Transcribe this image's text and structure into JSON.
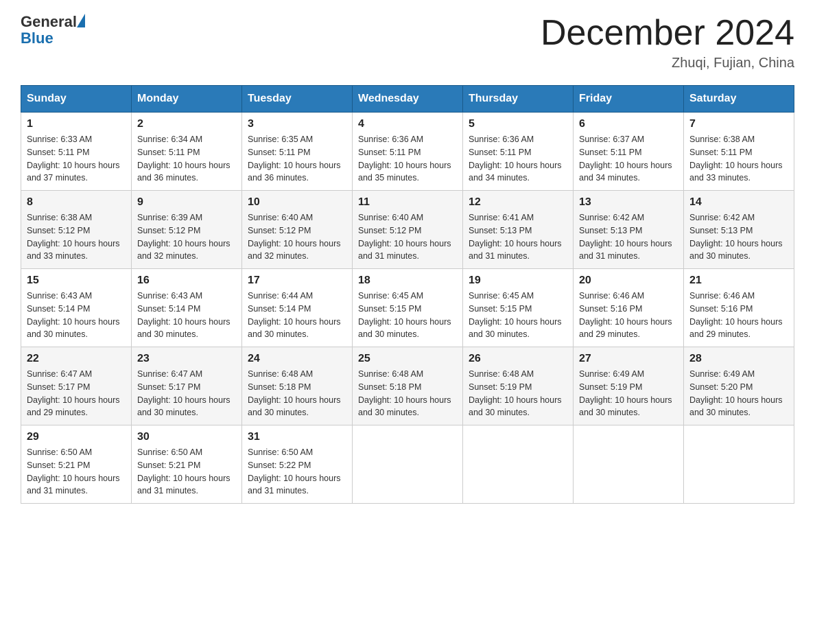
{
  "header": {
    "logo_general": "General",
    "logo_blue": "Blue",
    "month_year": "December 2024",
    "location": "Zhuqi, Fujian, China"
  },
  "calendar": {
    "days_of_week": [
      "Sunday",
      "Monday",
      "Tuesday",
      "Wednesday",
      "Thursday",
      "Friday",
      "Saturday"
    ],
    "weeks": [
      [
        {
          "day": "1",
          "sunrise": "6:33 AM",
          "sunset": "5:11 PM",
          "daylight": "10 hours and 37 minutes."
        },
        {
          "day": "2",
          "sunrise": "6:34 AM",
          "sunset": "5:11 PM",
          "daylight": "10 hours and 36 minutes."
        },
        {
          "day": "3",
          "sunrise": "6:35 AM",
          "sunset": "5:11 PM",
          "daylight": "10 hours and 36 minutes."
        },
        {
          "day": "4",
          "sunrise": "6:36 AM",
          "sunset": "5:11 PM",
          "daylight": "10 hours and 35 minutes."
        },
        {
          "day": "5",
          "sunrise": "6:36 AM",
          "sunset": "5:11 PM",
          "daylight": "10 hours and 34 minutes."
        },
        {
          "day": "6",
          "sunrise": "6:37 AM",
          "sunset": "5:11 PM",
          "daylight": "10 hours and 34 minutes."
        },
        {
          "day": "7",
          "sunrise": "6:38 AM",
          "sunset": "5:11 PM",
          "daylight": "10 hours and 33 minutes."
        }
      ],
      [
        {
          "day": "8",
          "sunrise": "6:38 AM",
          "sunset": "5:12 PM",
          "daylight": "10 hours and 33 minutes."
        },
        {
          "day": "9",
          "sunrise": "6:39 AM",
          "sunset": "5:12 PM",
          "daylight": "10 hours and 32 minutes."
        },
        {
          "day": "10",
          "sunrise": "6:40 AM",
          "sunset": "5:12 PM",
          "daylight": "10 hours and 32 minutes."
        },
        {
          "day": "11",
          "sunrise": "6:40 AM",
          "sunset": "5:12 PM",
          "daylight": "10 hours and 31 minutes."
        },
        {
          "day": "12",
          "sunrise": "6:41 AM",
          "sunset": "5:13 PM",
          "daylight": "10 hours and 31 minutes."
        },
        {
          "day": "13",
          "sunrise": "6:42 AM",
          "sunset": "5:13 PM",
          "daylight": "10 hours and 31 minutes."
        },
        {
          "day": "14",
          "sunrise": "6:42 AM",
          "sunset": "5:13 PM",
          "daylight": "10 hours and 30 minutes."
        }
      ],
      [
        {
          "day": "15",
          "sunrise": "6:43 AM",
          "sunset": "5:14 PM",
          "daylight": "10 hours and 30 minutes."
        },
        {
          "day": "16",
          "sunrise": "6:43 AM",
          "sunset": "5:14 PM",
          "daylight": "10 hours and 30 minutes."
        },
        {
          "day": "17",
          "sunrise": "6:44 AM",
          "sunset": "5:14 PM",
          "daylight": "10 hours and 30 minutes."
        },
        {
          "day": "18",
          "sunrise": "6:45 AM",
          "sunset": "5:15 PM",
          "daylight": "10 hours and 30 minutes."
        },
        {
          "day": "19",
          "sunrise": "6:45 AM",
          "sunset": "5:15 PM",
          "daylight": "10 hours and 30 minutes."
        },
        {
          "day": "20",
          "sunrise": "6:46 AM",
          "sunset": "5:16 PM",
          "daylight": "10 hours and 29 minutes."
        },
        {
          "day": "21",
          "sunrise": "6:46 AM",
          "sunset": "5:16 PM",
          "daylight": "10 hours and 29 minutes."
        }
      ],
      [
        {
          "day": "22",
          "sunrise": "6:47 AM",
          "sunset": "5:17 PM",
          "daylight": "10 hours and 29 minutes."
        },
        {
          "day": "23",
          "sunrise": "6:47 AM",
          "sunset": "5:17 PM",
          "daylight": "10 hours and 30 minutes."
        },
        {
          "day": "24",
          "sunrise": "6:48 AM",
          "sunset": "5:18 PM",
          "daylight": "10 hours and 30 minutes."
        },
        {
          "day": "25",
          "sunrise": "6:48 AM",
          "sunset": "5:18 PM",
          "daylight": "10 hours and 30 minutes."
        },
        {
          "day": "26",
          "sunrise": "6:48 AM",
          "sunset": "5:19 PM",
          "daylight": "10 hours and 30 minutes."
        },
        {
          "day": "27",
          "sunrise": "6:49 AM",
          "sunset": "5:19 PM",
          "daylight": "10 hours and 30 minutes."
        },
        {
          "day": "28",
          "sunrise": "6:49 AM",
          "sunset": "5:20 PM",
          "daylight": "10 hours and 30 minutes."
        }
      ],
      [
        {
          "day": "29",
          "sunrise": "6:50 AM",
          "sunset": "5:21 PM",
          "daylight": "10 hours and 31 minutes."
        },
        {
          "day": "30",
          "sunrise": "6:50 AM",
          "sunset": "5:21 PM",
          "daylight": "10 hours and 31 minutes."
        },
        {
          "day": "31",
          "sunrise": "6:50 AM",
          "sunset": "5:22 PM",
          "daylight": "10 hours and 31 minutes."
        },
        null,
        null,
        null,
        null
      ]
    ],
    "sunrise_label": "Sunrise:",
    "sunset_label": "Sunset:",
    "daylight_label": "Daylight:"
  }
}
